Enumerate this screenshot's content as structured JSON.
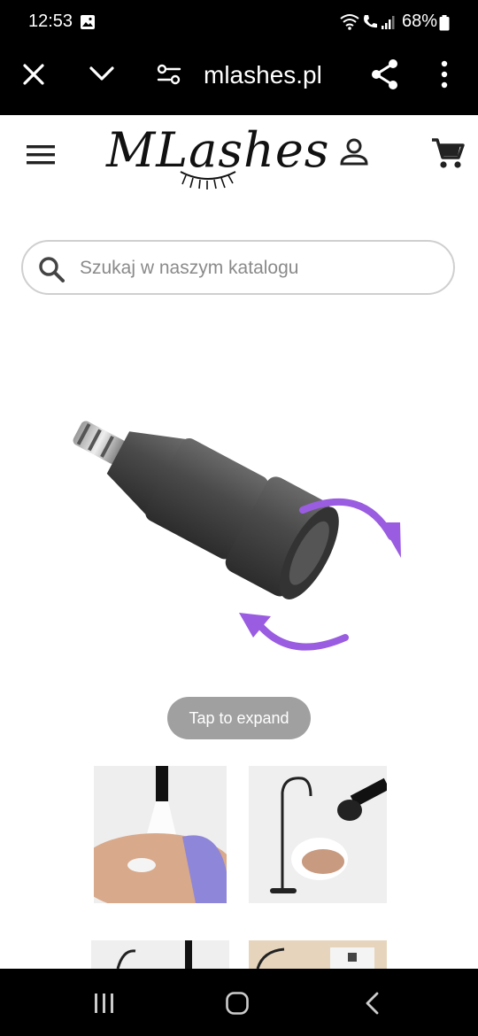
{
  "status": {
    "time": "12:53",
    "battery": "68%"
  },
  "browser": {
    "url": "mlashes.pl"
  },
  "site": {
    "logo": "MLashes"
  },
  "search": {
    "placeholder": "Szukaj w naszym katalogu"
  },
  "product": {
    "expand_label": "Tap to expand"
  },
  "colors": {
    "accent_arrow": "#9a5ce0",
    "header_bg": "#000000",
    "pill_bg": "#a0a0a0"
  },
  "icons": {
    "status": [
      "image-icon",
      "wifi-icon",
      "wifi-calling-icon",
      "signal-icon",
      "battery-icon"
    ],
    "browser": [
      "close-icon",
      "chevron-down-icon",
      "page-settings-icon",
      "share-icon",
      "more-vert-icon"
    ],
    "site": [
      "menu-icon",
      "account-icon",
      "cart-icon",
      "search-icon"
    ],
    "nav": [
      "recent-apps-icon",
      "home-icon",
      "back-icon"
    ]
  }
}
